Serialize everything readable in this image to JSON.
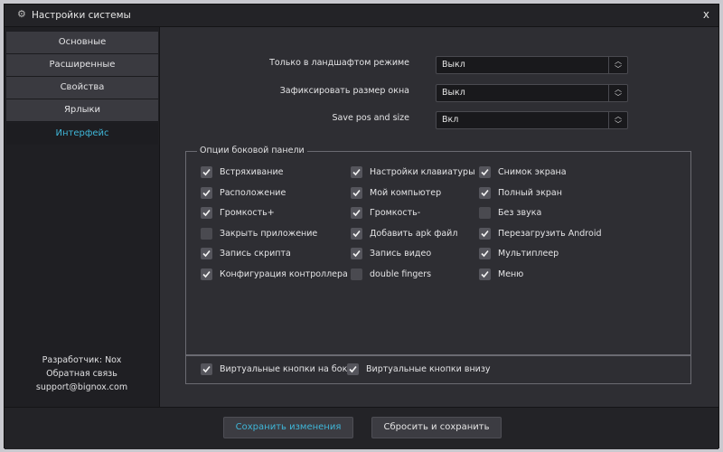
{
  "window": {
    "title": "Настройки системы",
    "close_glyph": "x",
    "gear_glyph": "⚙"
  },
  "sidebar": {
    "items": [
      {
        "label": "Основные",
        "active": false
      },
      {
        "label": "Расширенные",
        "active": false
      },
      {
        "label": "Свойства",
        "active": false
      },
      {
        "label": "Ярлыки",
        "active": false
      },
      {
        "label": "Интерфейс",
        "active": true
      }
    ],
    "footer": {
      "developer": "Разработчик: Nox",
      "feedback": "Обратная связь",
      "email": "support@bignox.com"
    }
  },
  "settings": [
    {
      "label": "Только в ландшафтом режиме",
      "value": "Выкл"
    },
    {
      "label": "Зафиксировать размер окна",
      "value": "Выкл"
    },
    {
      "label": "Save pos and size",
      "value": "Вкл"
    }
  ],
  "side_panel": {
    "title": "Опции боковой панели",
    "columns": [
      [
        {
          "label": "Встряхивание",
          "checked": true
        },
        {
          "label": "Расположение",
          "checked": true
        },
        {
          "label": "Громкость+",
          "checked": true
        },
        {
          "label": "Закрыть приложение",
          "checked": false
        },
        {
          "label": "Запись скрипта",
          "checked": true
        },
        {
          "label": "Конфигурация контроллера",
          "checked": true
        }
      ],
      [
        {
          "label": "Настройки клавиатуры",
          "checked": true
        },
        {
          "label": "Мой компьютер",
          "checked": true
        },
        {
          "label": "Громкость-",
          "checked": true
        },
        {
          "label": "Добавить apk файл",
          "checked": true
        },
        {
          "label": "Запись видео",
          "checked": true
        },
        {
          "label": "double fingers",
          "checked": false
        }
      ],
      [
        {
          "label": "Снимок экрана",
          "checked": true
        },
        {
          "label": "Полный экран",
          "checked": true
        },
        {
          "label": "Без звука",
          "checked": false
        },
        {
          "label": "Перезагрузить Android",
          "checked": true
        },
        {
          "label": "Мультиплеер",
          "checked": true
        },
        {
          "label": "Меню",
          "checked": true
        }
      ]
    ],
    "virtual": [
      {
        "label": "Виртуальные кнопки на боку",
        "checked": true
      },
      {
        "label": "Виртуальные кнопки внизу",
        "checked": true
      }
    ]
  },
  "buttons": {
    "save": "Сохранить изменения",
    "reset": "Сбросить и сохранить"
  },
  "colors": {
    "accent": "#3fb6d8",
    "background": "#2e2e33",
    "sidebar": "#1f1f23"
  }
}
